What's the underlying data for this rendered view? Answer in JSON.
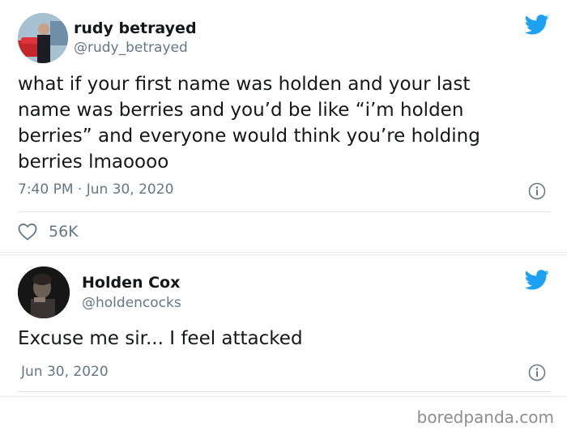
{
  "tweets": [
    {
      "display_name": "rudy betrayed",
      "handle": "@rudy_betrayed",
      "text_lines": [
        "what if your first name was holden and your last",
        "name was berries and you’d be like “i’m holden",
        "berries” and everyone would think you’re holding",
        "berries lmaoooo"
      ],
      "timestamp": "7:40 PM · Jun 30, 2020",
      "likes": "56K"
    },
    {
      "display_name": "Holden Cox",
      "handle": "@holdencocks",
      "text_lines": [
        "Excuse me sir... I feel attacked"
      ],
      "timestamp": "Jun 30, 2020"
    }
  ],
  "icons": {
    "bird": "twitter-bird-icon",
    "info": "info-icon",
    "like": "heart-icon"
  },
  "colors": {
    "twitter_blue": "#1da1f2",
    "secondary_text": "#657786",
    "primary_text": "#14171a"
  },
  "watermark": "boredpanda.com"
}
